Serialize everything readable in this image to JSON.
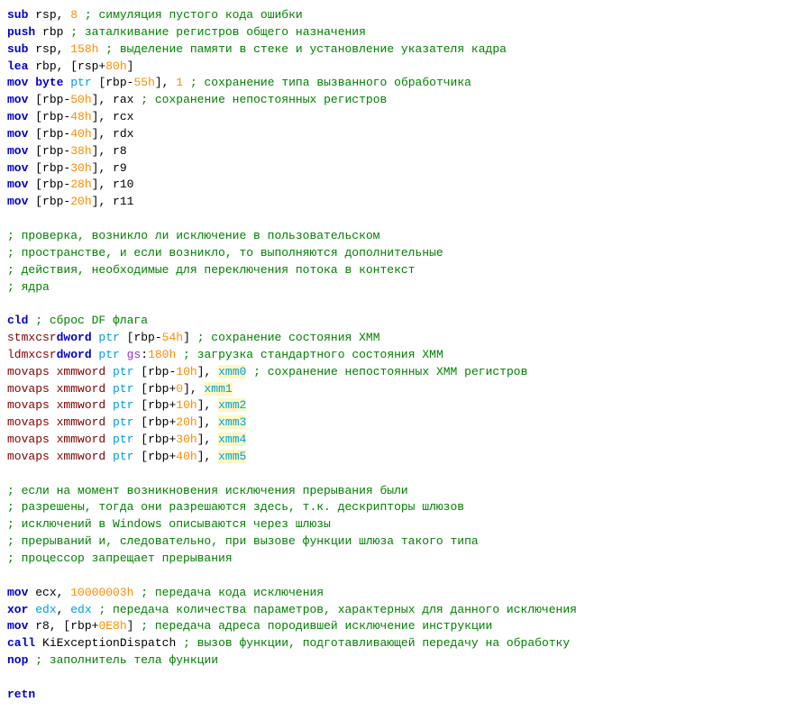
{
  "lines": [
    {
      "t": "instr",
      "mn": "sub",
      "ops": [
        [
          "black",
          "rsp, "
        ],
        [
          "orange",
          "8"
        ]
      ],
      "cm": "; симуляция пустого кода ошибки"
    },
    {
      "t": "instr",
      "mn": "push",
      "ops": [
        [
          "black",
          "rbp"
        ]
      ],
      "cm": "; заталкивание регистров общего назначения"
    },
    {
      "t": "instr",
      "mn": "sub",
      "ops": [
        [
          "black",
          "rsp, "
        ],
        [
          "orange",
          "158h"
        ]
      ],
      "cm": "; выделение памяти в стеке и установление указателя кадра"
    },
    {
      "t": "instr",
      "mn": "lea",
      "ops": [
        [
          "black",
          "rbp, [rsp+"
        ],
        [
          "orange",
          "80h"
        ],
        [
          "black",
          "]"
        ]
      ],
      "cm": null
    },
    {
      "t": "instr",
      "mn": "mov",
      "ops": [
        [
          "blue",
          "byte "
        ],
        [
          "lightblue",
          "ptr "
        ],
        [
          "black",
          "[rbp-"
        ],
        [
          "orange",
          "55h"
        ],
        [
          "black",
          "], "
        ],
        [
          "orange",
          "1"
        ]
      ],
      "cm": "; сохранение типа вызванного обработчика"
    },
    {
      "t": "instr",
      "mn": "mov",
      "ops": [
        [
          "black",
          "[rbp-"
        ],
        [
          "orange",
          "50h"
        ],
        [
          "black",
          "], rax"
        ]
      ],
      "cm": "; сохранение непостоянных регистров"
    },
    {
      "t": "instr",
      "mn": "mov",
      "ops": [
        [
          "black",
          "[rbp-"
        ],
        [
          "orange",
          "48h"
        ],
        [
          "black",
          "], rcx"
        ]
      ],
      "cm": null
    },
    {
      "t": "instr",
      "mn": "mov",
      "ops": [
        [
          "black",
          "[rbp-"
        ],
        [
          "orange",
          "40h"
        ],
        [
          "black",
          "], rdx"
        ]
      ],
      "cm": null
    },
    {
      "t": "instr",
      "mn": "mov",
      "ops": [
        [
          "black",
          "[rbp-"
        ],
        [
          "orange",
          "38h"
        ],
        [
          "black",
          "], r8"
        ]
      ],
      "cm": null
    },
    {
      "t": "instr",
      "mn": "mov",
      "ops": [
        [
          "black",
          "[rbp-"
        ],
        [
          "orange",
          "30h"
        ],
        [
          "black",
          "], r9"
        ]
      ],
      "cm": null
    },
    {
      "t": "instr",
      "mn": "mov",
      "ops": [
        [
          "black",
          "[rbp-"
        ],
        [
          "orange",
          "28h"
        ],
        [
          "black",
          "], r10"
        ]
      ],
      "cm": null
    },
    {
      "t": "instr",
      "mn": "mov",
      "ops": [
        [
          "black",
          "[rbp-"
        ],
        [
          "orange",
          "20h"
        ],
        [
          "black",
          "], r11"
        ]
      ],
      "cm": null
    },
    {
      "t": "blank"
    },
    {
      "t": "cm",
      "text": "; проверка, возникло ли исключение в пользовательском"
    },
    {
      "t": "cm",
      "text": "; пространстве, и если возникло, то выполняются дополнительные"
    },
    {
      "t": "cm",
      "text": "; действия, необходимые для переключения потока в контекст"
    },
    {
      "t": "cm",
      "text": "; ядра"
    },
    {
      "t": "blank"
    },
    {
      "t": "instr0",
      "mn": "cld",
      "opcol": 7,
      "ops": [],
      "cm": "; сброс DF флага"
    },
    {
      "t": "instr0",
      "mn": "stmxcsr",
      "opcol": 7,
      "ops": [
        [
          "blue",
          "dword "
        ],
        [
          "lightblue",
          "ptr "
        ],
        [
          "black",
          "[rbp-"
        ],
        [
          "orange",
          "54h"
        ],
        [
          "black",
          "]"
        ]
      ],
      "cm": "; сохранение состояния XMM"
    },
    {
      "t": "instr0",
      "mn": "ldmxcsr",
      "opcol": 7,
      "ops": [
        [
          "blue",
          "dword "
        ],
        [
          "lightblue",
          "ptr "
        ],
        [
          "orchid",
          "gs"
        ],
        [
          "black",
          ":"
        ],
        [
          "orange",
          "180h"
        ]
      ],
      "cm": "; загрузка стандартного состояния XMM"
    },
    {
      "t": "instr0",
      "mn": "movaps",
      "opcol": 7,
      "ops": [
        [
          "maroon",
          "xmmword "
        ],
        [
          "lightblue",
          "ptr "
        ],
        [
          "black",
          "[rbp-"
        ],
        [
          "orange",
          "10h"
        ],
        [
          "black",
          "], "
        ],
        [
          "lightbluehl",
          "xmm0"
        ]
      ],
      "cm": "; сохранение непостоянных XMM регистров"
    },
    {
      "t": "instr0",
      "mn": "movaps",
      "opcol": 7,
      "ops": [
        [
          "maroon",
          "xmmword "
        ],
        [
          "lightblue",
          "ptr "
        ],
        [
          "black",
          "[rbp+"
        ],
        [
          "orange",
          "0"
        ],
        [
          "black",
          "], "
        ],
        [
          "lightbluehl",
          "xmm1"
        ]
      ],
      "cm": null
    },
    {
      "t": "instr0",
      "mn": "movaps",
      "opcol": 7,
      "ops": [
        [
          "maroon",
          "xmmword "
        ],
        [
          "lightblue",
          "ptr "
        ],
        [
          "black",
          "[rbp+"
        ],
        [
          "orange",
          "10h"
        ],
        [
          "black",
          "], "
        ],
        [
          "lightbluehl",
          "xmm2"
        ]
      ],
      "cm": null
    },
    {
      "t": "instr0",
      "mn": "movaps",
      "opcol": 7,
      "ops": [
        [
          "maroon",
          "xmmword "
        ],
        [
          "lightblue",
          "ptr "
        ],
        [
          "black",
          "[rbp+"
        ],
        [
          "orange",
          "20h"
        ],
        [
          "black",
          "], "
        ],
        [
          "lightbluehl",
          "xmm3"
        ]
      ],
      "cm": null
    },
    {
      "t": "instr0",
      "mn": "movaps",
      "opcol": 7,
      "ops": [
        [
          "maroon",
          "xmmword "
        ],
        [
          "lightblue",
          "ptr "
        ],
        [
          "black",
          "[rbp+"
        ],
        [
          "orange",
          "30h"
        ],
        [
          "black",
          "], "
        ],
        [
          "lightbluehl",
          "xmm4"
        ]
      ],
      "cm": null
    },
    {
      "t": "instr0",
      "mn": "movaps",
      "opcol": 7,
      "ops": [
        [
          "maroon",
          "xmmword "
        ],
        [
          "lightblue",
          "ptr "
        ],
        [
          "black",
          "[rbp+"
        ],
        [
          "orange",
          "40h"
        ],
        [
          "black",
          "], "
        ],
        [
          "lightbluehl",
          "xmm5"
        ]
      ],
      "cm": null
    },
    {
      "t": "blank"
    },
    {
      "t": "cm",
      "text": "; если на момент возникновения исключения прерывания были"
    },
    {
      "t": "cm",
      "text": "; разрешены, тогда они разрешаются здесь, т.к. дескрипторы шлюзов"
    },
    {
      "t": "cm",
      "text": "; исключений в Windows описываются через шлюзы"
    },
    {
      "t": "cm",
      "text": "; прерываний и, следовательно, при вызове функции шлюза такого типа"
    },
    {
      "t": "cm",
      "text": "; процессор запрещает прерывания"
    },
    {
      "t": "blank"
    },
    {
      "t": "instr",
      "mn": "mov",
      "ops": [
        [
          "black",
          "ecx, "
        ],
        [
          "orange",
          "10000003h"
        ]
      ],
      "cm": "; передача кода исключения"
    },
    {
      "t": "instr",
      "mn": "xor",
      "ops": [
        [
          "lightblue",
          "edx"
        ],
        [
          "black",
          ", "
        ],
        [
          "lightblue",
          "edx"
        ]
      ],
      "cm": "; передача количества параметров, характерных для данного исключения"
    },
    {
      "t": "instr",
      "mn": "mov",
      "ops": [
        [
          "black",
          "r8, [rbp+"
        ],
        [
          "orange",
          "0E8h"
        ],
        [
          "black",
          "]"
        ]
      ],
      "cm": "; передача адреса породившей исключение инструкции"
    },
    {
      "t": "instr",
      "mn": "call",
      "ops": [
        [
          "black",
          "KiExceptionDispatch"
        ]
      ],
      "cm": "; вызов функции, подготавливающей передачу на обработку"
    },
    {
      "t": "instr",
      "mn": "nop",
      "ops": [],
      "cm": "; заполнитель тела функции"
    },
    {
      "t": "blank"
    },
    {
      "t": "instr0",
      "mn": "retn",
      "opcol": 7,
      "ops": [],
      "cm": null
    }
  ],
  "layout": {
    "mnemonicStart": 0,
    "operandStartStd": 7,
    "commentStart": 47
  }
}
